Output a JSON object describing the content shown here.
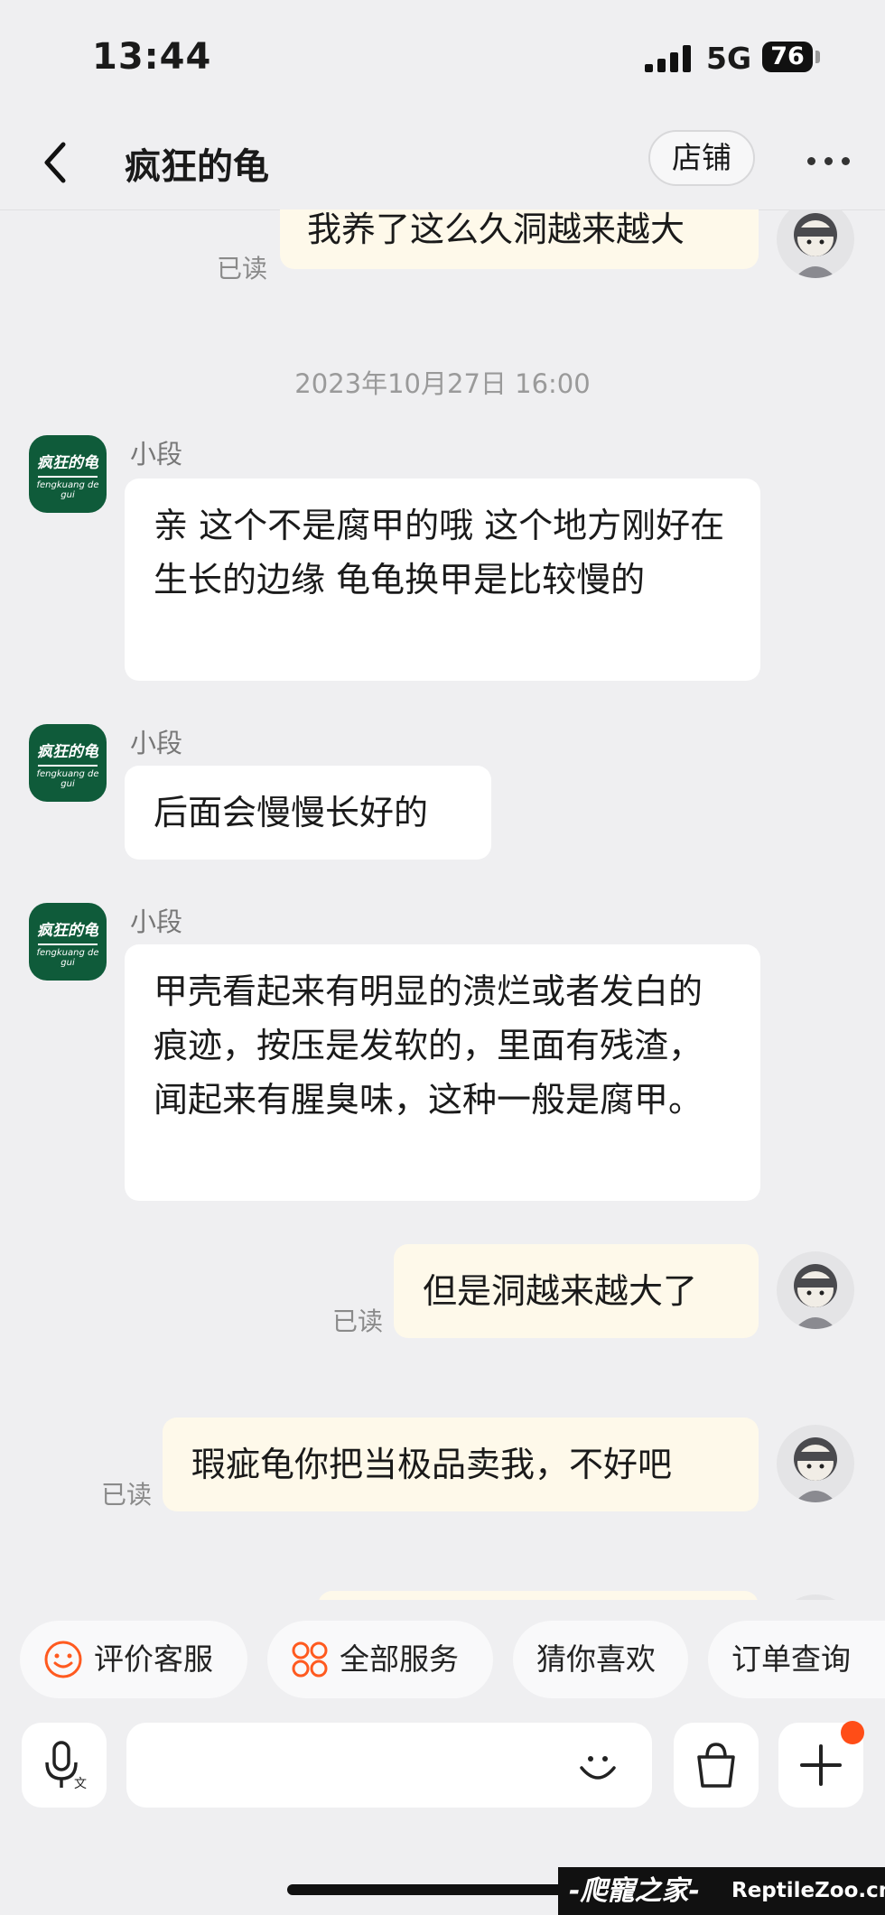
{
  "status_bar": {
    "time": "13:44",
    "network": "5G",
    "battery": "76"
  },
  "nav": {
    "title": "疯狂的龟",
    "shop_button": "店铺"
  },
  "shop_avatar": {
    "text_top": "疯狂的龟",
    "text_bottom": "fengkuang de gui"
  },
  "messages": [
    {
      "side": "out",
      "text": "我养了这么久洞越来越大",
      "read": "已读"
    },
    {
      "side": "in",
      "sender": "小段",
      "text": "亲 这个不是腐甲的哦 这个地方刚好在生长的边缘  龟龟换甲是比较慢的"
    },
    {
      "side": "in",
      "sender": "小段",
      "text": "后面会慢慢长好的"
    },
    {
      "side": "in",
      "sender": "小段",
      "text": "甲壳看起来有明显的溃烂或者发白的痕迹，按压是发软的，里面有残渣，闻起来有腥臭味，这种一般是腐甲。"
    },
    {
      "side": "out",
      "text": "但是洞越来越大了",
      "read": "已读"
    },
    {
      "side": "out",
      "text": "瑕疵龟你把当极品卖我，不好吧",
      "read": "已读"
    }
  ],
  "timestamp": "2023年10月27日 16:00",
  "quick_actions": [
    "评价客服",
    "全部服务",
    "猜你喜欢",
    "订单查询"
  ],
  "watermark": {
    "cn": "-爬寵之家-",
    "en": "ReptileZoo.cn"
  },
  "colors": {
    "accent": "#ff5a1f",
    "shop_green": "#0f5b3a",
    "out_bubble": "#fef9ea"
  }
}
